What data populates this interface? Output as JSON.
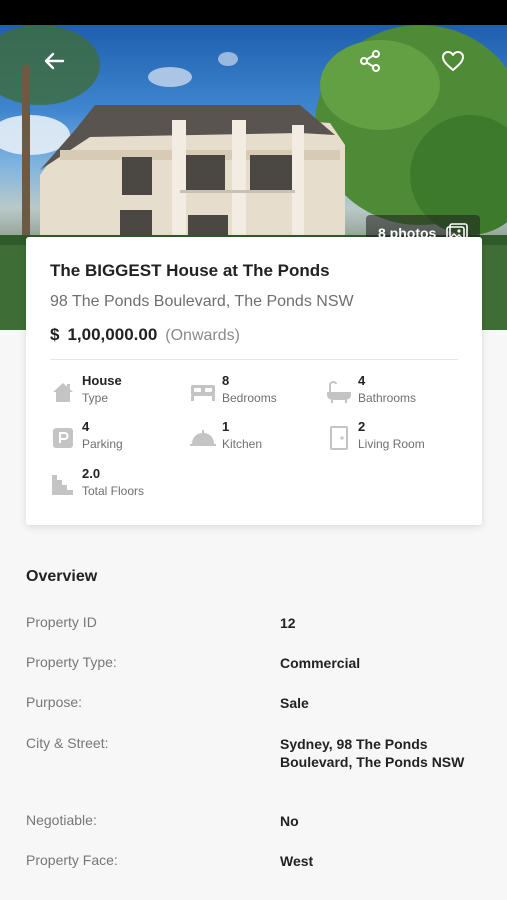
{
  "hero": {
    "photos_label": "8 photos"
  },
  "property": {
    "title": "The BIGGEST House at The Ponds",
    "address": "98 The Ponds Boulevard, The Ponds NSW",
    "price_currency": "$",
    "price_value": "1,00,000.00",
    "price_note": "(Onwards)"
  },
  "features": [
    {
      "value": "House",
      "label": "Type",
      "icon": "house-icon"
    },
    {
      "value": "8",
      "label": "Bedrooms",
      "icon": "bed-icon"
    },
    {
      "value": "4",
      "label": "Bathrooms",
      "icon": "bathtub-icon"
    },
    {
      "value": "4",
      "label": "Parking",
      "icon": "parking-icon"
    },
    {
      "value": "1",
      "label": "Kitchen",
      "icon": "kitchen-icon"
    },
    {
      "value": "2",
      "label": "Living Room",
      "icon": "door-icon"
    },
    {
      "value": "2.0",
      "label": "Total Floors",
      "icon": "stairs-icon"
    }
  ],
  "overview": {
    "title": "Overview",
    "rows": [
      {
        "key": "Property ID",
        "value": "12"
      },
      {
        "key": "Property Type:",
        "value": "Commercial"
      },
      {
        "key": "Purpose:",
        "value": "Sale"
      },
      {
        "key": "City & Street:",
        "value": "Sydney, 98 The Ponds Boulevard, The Ponds NSW"
      },
      {
        "key": "Negotiable:",
        "value": "No"
      },
      {
        "key": "Property Face:",
        "value": "West"
      }
    ]
  },
  "colors": {
    "text_primary": "#222222",
    "text_secondary": "#6f6f6f",
    "icon_gray": "#c4c4c4"
  }
}
